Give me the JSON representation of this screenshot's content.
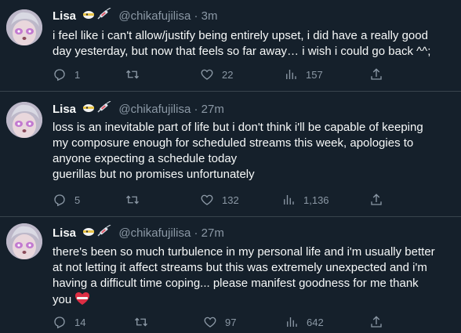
{
  "tweets": [
    {
      "name": "Lisa",
      "handle": "@chikafujilisa",
      "sep": "·",
      "time": "3m",
      "lines": [
        "i feel like i can't allow/justify being entirely upset, i did have a really good",
        "day yesterday, but now that feels so far away… i wish i could go back ^^;"
      ],
      "replies": "1",
      "retweets": "",
      "likes": "22",
      "views": "157"
    },
    {
      "name": "Lisa",
      "handle": "@chikafujilisa",
      "sep": "·",
      "time": "27m",
      "lines": [
        "loss is an inevitable part of life but i don't think i'll be capable of keeping",
        "my composure enough for scheduled streams this week, apologies to",
        "anyone expecting a schedule today",
        "guerillas but no promises unfortunately"
      ],
      "replies": "5",
      "retweets": "",
      "likes": "132",
      "views": "1,136"
    },
    {
      "name": "Lisa",
      "handle": "@chikafujilisa",
      "sep": "·",
      "time": "27m",
      "lines": [
        "there's been so much turbulence in my personal life and i'm usually better",
        "at not letting it affect streams but this was extremely unexpected and i'm",
        "having a difficult time coping... please manifest goodness for me thank",
        "you"
      ],
      "replies": "14",
      "retweets": "",
      "likes": "97",
      "views": "642"
    }
  ],
  "icons": {
    "reply": "reply-icon",
    "retweet": "retweet-icon",
    "like": "heart-icon",
    "views": "views-icon",
    "share": "share-icon",
    "badge1": "eye-patch-emoji-icon",
    "badge2": "syringe-emoji-icon",
    "heart_emoji": "mending-heart-emoji-icon"
  },
  "colors": {
    "background": "#15202b",
    "text": "#f7f9f9",
    "secondary": "#8b98a5",
    "divider": "#38444d"
  }
}
